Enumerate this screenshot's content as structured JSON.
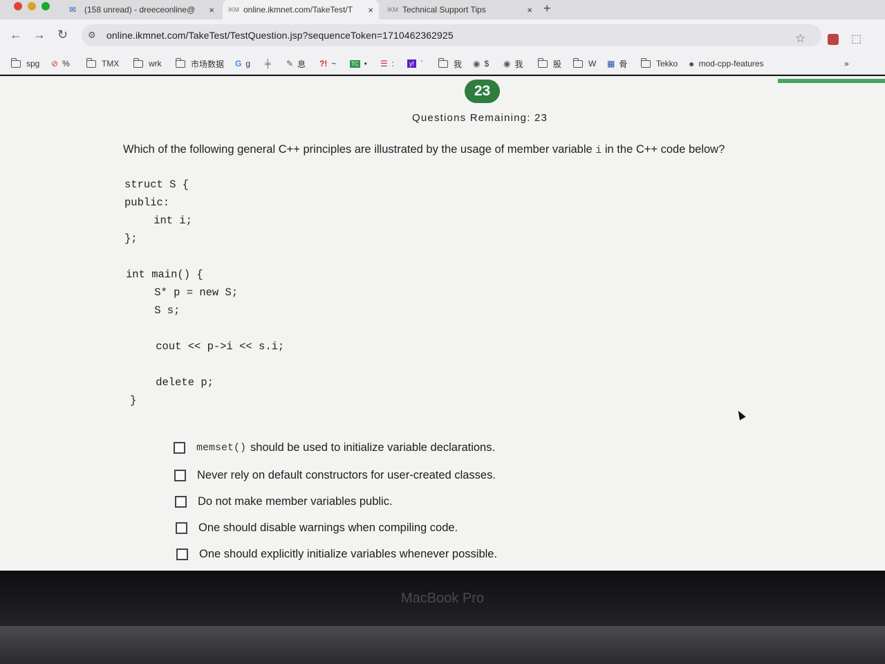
{
  "tabs": [
    {
      "label": "(158 unread) - dreeceonline@",
      "icon": "mail-icon",
      "active": false
    },
    {
      "label": "online.ikmnet.com/TakeTest/T",
      "icon": "ikm-icon",
      "active": true
    },
    {
      "label": "Technical Support Tips",
      "icon": "ikm-icon",
      "active": false
    }
  ],
  "tab_icon_text": "IKM",
  "new_tab_label": "+",
  "address": {
    "url": "online.ikmnet.com/TakeTest/TestQuestion.jsp?sequenceToken=1710462362925"
  },
  "bookmarks": [
    {
      "label": "spg",
      "icon": "folder-icon"
    },
    {
      "label": "%",
      "icon": "block-icon"
    },
    {
      "label": "TMX",
      "icon": "folder-icon"
    },
    {
      "label": "wrk",
      "icon": "folder-icon"
    },
    {
      "label": "市场数据",
      "icon": "folder-icon"
    },
    {
      "label": "g",
      "icon": "google-icon"
    },
    {
      "label": "息",
      "icon": "stroke-icon"
    },
    {
      "label": "~",
      "icon": "interrobang-icon"
    },
    {
      "label": "•",
      "icon": "tc-icon"
    },
    {
      "label": ":",
      "icon": "bars-icon"
    },
    {
      "label": "`",
      "icon": "yahoo-icon"
    },
    {
      "label": "我",
      "icon": "folder-icon"
    },
    {
      "label": "$",
      "icon": "globe-icon"
    },
    {
      "label": "我",
      "icon": "globe-icon"
    },
    {
      "label": "股",
      "icon": "folder-icon"
    },
    {
      "label": "W",
      "icon": "folder-icon"
    },
    {
      "label": "骨",
      "icon": "grid-icon"
    },
    {
      "label": "Tekko",
      "icon": "folder-icon"
    },
    {
      "label": "mod-cpp-features",
      "icon": "github-icon"
    }
  ],
  "bookmarks_overflow": "»",
  "question": {
    "number": "23",
    "remaining": "Questions Remaining: 23",
    "text_before": "Which of the following general C++ principles are illustrated by the usage of member variable ",
    "code_ref": "i",
    "text_after": " in the C++ code below?"
  },
  "code_lines": [
    "struct S {",
    "public:",
    "    int i;",
    "};",
    "",
    "int main() {",
    "    S* p = new S;",
    "    S s;",
    "",
    "    cout << p->i << s.i;",
    "",
    "    delete p;",
    "}"
  ],
  "options": [
    {
      "code": "memset()",
      "text": "should be used to initialize variable declarations.",
      "checked": false
    },
    {
      "code": "",
      "text": "Never rely on default constructors for user-created classes.",
      "checked": false
    },
    {
      "code": "",
      "text": "Do not make member variables public.",
      "checked": false
    },
    {
      "code": "",
      "text": "One should disable warnings when compiling code.",
      "checked": false
    },
    {
      "code": "",
      "text": "One should explicitly initialize variables whenever possible.",
      "checked": false
    }
  ],
  "device_label": "MacBook Pro",
  "colors": {
    "badge": "#2e7d3f",
    "progress": "#4aa35c"
  }
}
